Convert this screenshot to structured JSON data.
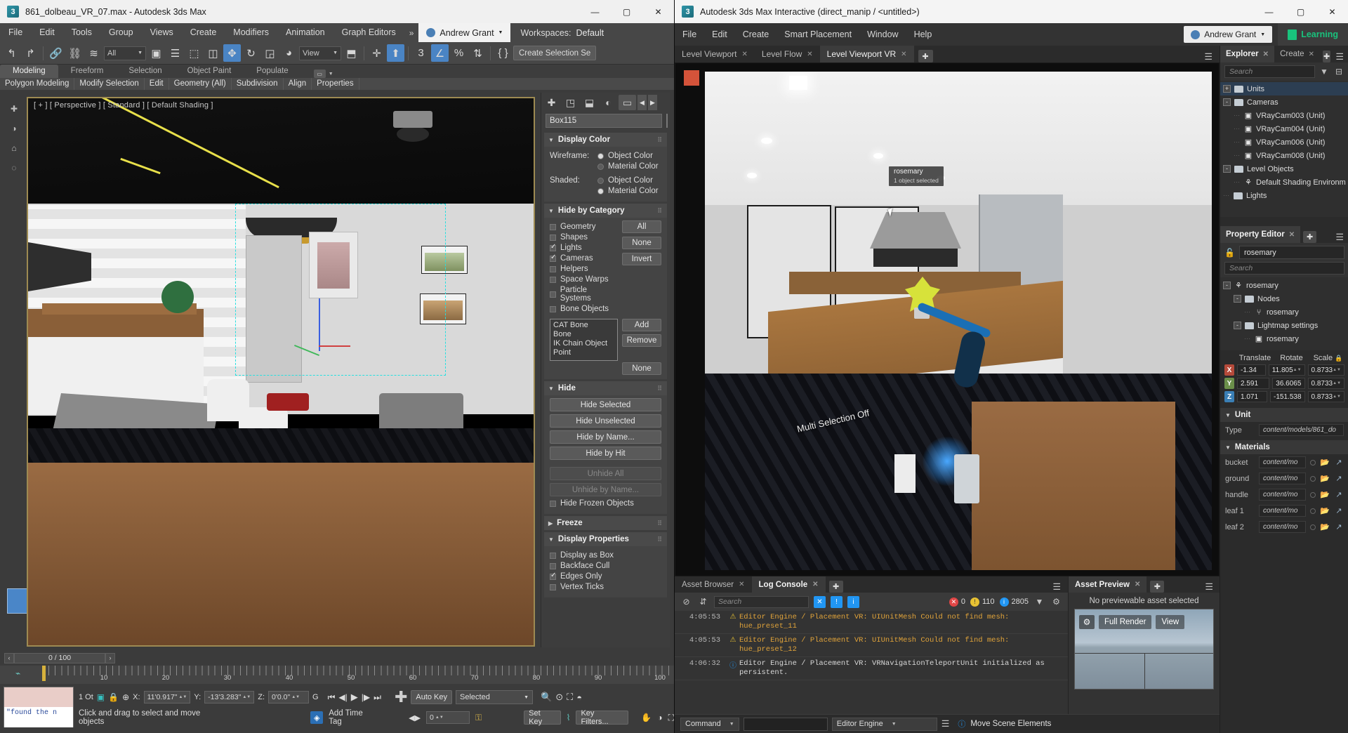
{
  "max": {
    "titlebar": {
      "title": "861_dolbeau_VR_07.max - Autodesk 3ds Max",
      "minimize": "—",
      "maximize": "▢",
      "close": "✕"
    },
    "menus": [
      "File",
      "Edit",
      "Tools",
      "Group",
      "Views",
      "Create",
      "Modifiers",
      "Animation",
      "Graph Editors"
    ],
    "menu_overflow": "»",
    "user": "Andrew Grant",
    "workspace_label": "Workspaces:",
    "workspace_value": "Default",
    "toolbar": {
      "filter_combo": "All",
      "ref_combo": "View",
      "create_selection_set": "Create Selection Se"
    },
    "ribbon_tabs": [
      "Modeling",
      "Freeform",
      "Selection",
      "Object Paint",
      "Populate"
    ],
    "ribbon_selected": "Modeling",
    "ribbon_sub": [
      "Polygon Modeling",
      "Modify Selection",
      "Edit",
      "Geometry (All)",
      "Subdivision",
      "Align",
      "Properties"
    ],
    "viewport_label": "[ + ] [ Perspective ] [ Standard ] [ Default Shading ]",
    "command_panel": {
      "object_name": "Box115",
      "display_color": {
        "title": "Display Color",
        "wireframe_label": "Wireframe:",
        "shaded_label": "Shaded:",
        "option_object": "Object Color",
        "option_material": "Material Color",
        "wireframe_selected": "Object Color",
        "shaded_selected": "Material Color"
      },
      "hide_by_category": {
        "title": "Hide by Category",
        "items": [
          {
            "label": "Geometry",
            "checked": false
          },
          {
            "label": "Shapes",
            "checked": false
          },
          {
            "label": "Lights",
            "checked": true
          },
          {
            "label": "Cameras",
            "checked": true
          },
          {
            "label": "Helpers",
            "checked": false
          },
          {
            "label": "Space Warps",
            "checked": false
          },
          {
            "label": "Particle Systems",
            "checked": false
          },
          {
            "label": "Bone Objects",
            "checked": false
          }
        ],
        "buttons": [
          "All",
          "None",
          "Invert"
        ],
        "list_items": [
          "CAT Bone",
          "Bone",
          "IK Chain Object",
          "Point"
        ],
        "list_buttons": [
          "Add",
          "Remove",
          "None"
        ]
      },
      "hide": {
        "title": "Hide",
        "buttons": [
          "Hide Selected",
          "Hide Unselected",
          "Hide by Name...",
          "Hide by Hit"
        ],
        "disabled_buttons": [
          "Unhide All",
          "Unhide by Name..."
        ],
        "checkbox": {
          "label": "Hide Frozen Objects",
          "checked": false
        }
      },
      "freeze": {
        "title": "Freeze"
      },
      "display_properties": {
        "title": "Display Properties",
        "items": [
          {
            "label": "Display as Box",
            "checked": false
          },
          {
            "label": "Backface Cull",
            "checked": false
          },
          {
            "label": "Edges Only",
            "checked": true
          },
          {
            "label": "Vertex Ticks",
            "checked": false
          }
        ]
      }
    },
    "timeline": {
      "frame_display": "0 / 100",
      "prev": "‹",
      "next": "›",
      "ticks": [
        "10",
        "20",
        "30",
        "40",
        "50",
        "60",
        "70",
        "80",
        "90",
        "100"
      ]
    },
    "status": {
      "log_text": "\"found the n",
      "object_count": "1 Ot",
      "x_label": "X:",
      "x_value": "11'0.917\"",
      "y_label": "Y:",
      "y_value": "-13'3.283\"",
      "z_label": "Z:",
      "z_value": "0'0.0\"",
      "grid_label": "G",
      "prompt": "Click and drag to select and move objects",
      "add_time_tag": "Add Time Tag",
      "key_frame_value": "0",
      "auto_key": "Auto Key",
      "set_key": "Set Key",
      "key_filters": "Key Filters...",
      "selected_combo": "Selected"
    }
  },
  "mi": {
    "titlebar": {
      "title": "Autodesk 3ds Max Interactive (direct_manip / <untitled>)",
      "minimize": "—",
      "maximize": "▢",
      "close": "✕"
    },
    "menus": [
      "File",
      "Edit",
      "Create",
      "Smart Placement",
      "Window",
      "Help"
    ],
    "user": "Andrew Grant",
    "learning": "Learning",
    "viewport_tabs": [
      {
        "label": "Level Viewport",
        "active": false
      },
      {
        "label": "Level Flow",
        "active": false
      },
      {
        "label": "Level Viewport VR",
        "active": true
      }
    ],
    "viewport_overlays": {
      "selection_tag_title": "rosemary",
      "selection_tag_sub": "1 object selected",
      "multi_selection": "Multi Selection Off"
    },
    "explorer": {
      "tabs": [
        {
          "label": "Explorer",
          "active": true
        },
        {
          "label": "Create",
          "active": false
        }
      ],
      "search_placeholder": "Search",
      "tree": [
        {
          "label": "Units",
          "depth": 0,
          "type": "folder",
          "expander": "+",
          "selected": true
        },
        {
          "label": "Cameras",
          "depth": 0,
          "type": "folder",
          "expander": "-",
          "selected": false
        },
        {
          "label": "VRayCam003 (Unit)",
          "depth": 1,
          "type": "unit",
          "expander": "",
          "selected": false
        },
        {
          "label": "VRayCam004 (Unit)",
          "depth": 1,
          "type": "unit",
          "expander": "",
          "selected": false
        },
        {
          "label": "VRayCam006 (Unit)",
          "depth": 1,
          "type": "unit",
          "expander": "",
          "selected": false
        },
        {
          "label": "VRayCam008 (Unit)",
          "depth": 1,
          "type": "unit",
          "expander": "",
          "selected": false
        },
        {
          "label": "Level Objects",
          "depth": 0,
          "type": "folder",
          "expander": "-",
          "selected": false
        },
        {
          "label": "Default Shading Environm",
          "depth": 1,
          "type": "entity",
          "expander": "",
          "selected": false
        },
        {
          "label": "Lights",
          "depth": 0,
          "type": "folder",
          "expander": "",
          "selected": false
        }
      ]
    },
    "property_editor": {
      "tabs": [
        {
          "label": "Property Editor",
          "active": true
        }
      ],
      "name_value": "rosemary",
      "search_placeholder": "Search",
      "tree": [
        {
          "label": "rosemary",
          "depth": 0,
          "type": "entity",
          "expander": "-"
        },
        {
          "label": "Nodes",
          "depth": 1,
          "type": "folder",
          "expander": "-"
        },
        {
          "label": "rosemary",
          "depth": 2,
          "type": "node",
          "expander": ""
        },
        {
          "label": "Lightmap settings",
          "depth": 1,
          "type": "folder",
          "expander": "-"
        },
        {
          "label": "rosemary",
          "depth": 2,
          "type": "unit",
          "expander": ""
        }
      ],
      "transform_headers": [
        "Translate",
        "Rotate",
        "Scale"
      ],
      "transform_rows": [
        {
          "axis": "X",
          "translate": "-1.34",
          "rotate": "11.805",
          "scale": "0.8733"
        },
        {
          "axis": "Y",
          "translate": "2.591",
          "rotate": "36.6065",
          "scale": "0.8733"
        },
        {
          "axis": "Z",
          "translate": "1.071",
          "rotate": "-151.538",
          "scale": "0.8733"
        }
      ],
      "unit_section": {
        "title": "Unit",
        "type_label": "Type",
        "type_value": "content/models/861_do"
      },
      "materials_section": {
        "title": "Materials",
        "rows": [
          {
            "name": "bucket",
            "value": "content/mo"
          },
          {
            "name": "ground",
            "value": "content/mo"
          },
          {
            "name": "handle",
            "value": "content/mo"
          },
          {
            "name": "leaf 1",
            "value": "content/mo"
          },
          {
            "name": "leaf 2",
            "value": "content/mo"
          }
        ]
      }
    },
    "bottom": {
      "tabs": [
        {
          "label": "Asset Browser",
          "active": false
        },
        {
          "label": "Log Console",
          "active": true
        }
      ],
      "search_placeholder": "Search",
      "counts": {
        "errors": "0",
        "warnings": "110",
        "infos": "2805"
      },
      "log_rows": [
        {
          "time": "4:05:53",
          "level": "warn",
          "text": "Editor Engine / Placement VR: UIUnitMesh Could not find mesh: hue_preset_11"
        },
        {
          "time": "4:05:53",
          "level": "warn",
          "text": "Editor Engine / Placement VR: UIUnitMesh Could not find mesh: hue_preset_12"
        },
        {
          "time": "4:06:32",
          "level": "info",
          "text": "Editor Engine / Placement VR: VRNavigationTeleportUnit initialized as persistent."
        }
      ],
      "asset_preview": {
        "tabs": [
          {
            "label": "Asset Preview",
            "active": true
          }
        ],
        "empty_text": "No previewable asset selected",
        "full_render": "Full Render",
        "view": "View"
      },
      "command_bar": {
        "command_combo": "Command",
        "engine_combo": "Editor Engine",
        "status_text": "Move Scene Elements"
      }
    }
  },
  "colors": {
    "accent_blue": "#4a84c4",
    "warn": "#e0a33a",
    "error": "#e04646",
    "info": "#2196f3",
    "learning_green": "#19c37d"
  }
}
